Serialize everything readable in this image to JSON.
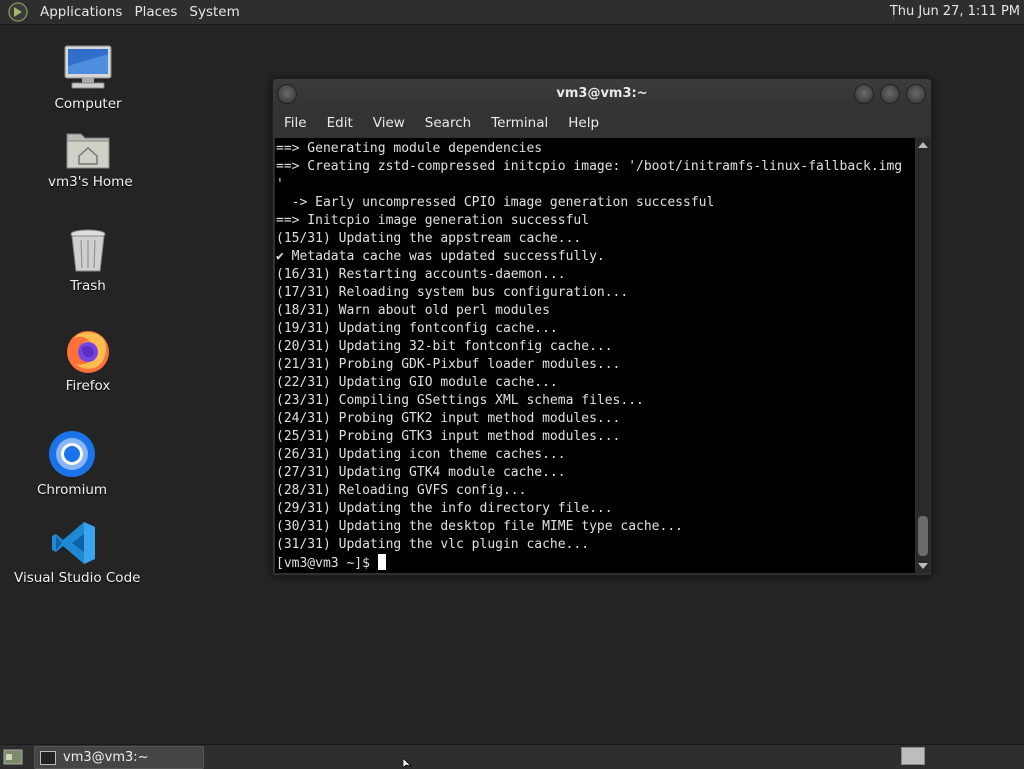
{
  "top_panel": {
    "menus": [
      "Applications",
      "Places",
      "System"
    ],
    "clock": "Thu Jun 27, 1:11 PM"
  },
  "desktop": {
    "icons": [
      {
        "label": "Computer",
        "icon": "computer-icon"
      },
      {
        "label": "vm3's Home",
        "icon": "home-folder-icon"
      },
      {
        "label": "Trash",
        "icon": "trash-icon"
      },
      {
        "label": "Firefox",
        "icon": "firefox-icon"
      },
      {
        "label": "Chromium",
        "icon": "chromium-icon"
      },
      {
        "label": "Visual Studio Code",
        "icon": "vscode-icon"
      }
    ]
  },
  "terminal": {
    "title": "vm3@vm3:~",
    "menu": [
      "File",
      "Edit",
      "View",
      "Search",
      "Terminal",
      "Help"
    ],
    "lines": [
      "==> Generating module dependencies",
      "==> Creating zstd-compressed initcpio image: '/boot/initramfs-linux-fallback.img",
      "'",
      "  -> Early uncompressed CPIO image generation successful",
      "==> Initcpio image generation successful",
      "(15/31) Updating the appstream cache...",
      "✔ Metadata cache was updated successfully.",
      "(16/31) Restarting accounts-daemon...",
      "(17/31) Reloading system bus configuration...",
      "(18/31) Warn about old perl modules",
      "(19/31) Updating fontconfig cache...",
      "(20/31) Updating 32-bit fontconfig cache...",
      "(21/31) Probing GDK-Pixbuf loader modules...",
      "(22/31) Updating GIO module cache...",
      "(23/31) Compiling GSettings XML schema files...",
      "(24/31) Probing GTK2 input method modules...",
      "(25/31) Probing GTK3 input method modules...",
      "(26/31) Updating icon theme caches...",
      "(27/31) Updating GTK4 module cache...",
      "(28/31) Reloading GVFS config...",
      "(29/31) Updating the info directory file...",
      "(30/31) Updating the desktop file MIME type cache...",
      "(31/31) Updating the vlc plugin cache..."
    ],
    "prompt": "[vm3@vm3 ~]$ "
  },
  "bottom_panel": {
    "task_label": "vm3@vm3:~"
  },
  "colors": {
    "desktop_bg": "#242424",
    "panel_bg": "#2e2e2e",
    "terminal_bg": "#000000",
    "terminal_fg": "#e0e0e0"
  }
}
